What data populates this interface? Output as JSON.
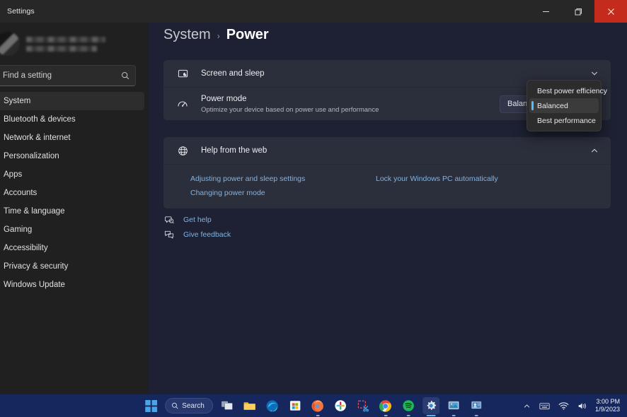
{
  "window": {
    "title": "Settings",
    "controls": {
      "minimize": "minimize",
      "restore": "restore",
      "close": "close"
    }
  },
  "sidebar": {
    "profile": {
      "redacted": true,
      "name_line": "",
      "account_line": ""
    },
    "search": {
      "value": "",
      "placeholder": "Find a setting",
      "icon": "search-icon"
    },
    "items": [
      {
        "label": "System",
        "selected": true
      },
      {
        "label": "Bluetooth & devices",
        "selected": false
      },
      {
        "label": "Network & internet",
        "selected": false
      },
      {
        "label": "Personalization",
        "selected": false
      },
      {
        "label": "Apps",
        "selected": false
      },
      {
        "label": "Accounts",
        "selected": false
      },
      {
        "label": "Time & language",
        "selected": false
      },
      {
        "label": "Gaming",
        "selected": false
      },
      {
        "label": "Accessibility",
        "selected": false
      },
      {
        "label": "Privacy & security",
        "selected": false
      },
      {
        "label": "Windows Update",
        "selected": false
      }
    ]
  },
  "breadcrumb": {
    "root": "System",
    "separator": "›",
    "current": "Power"
  },
  "settings": {
    "screen_and_sleep": {
      "title": "Screen and sleep",
      "icon": "monitor-sleep-icon",
      "expander": "chevron-down-icon"
    },
    "power_mode": {
      "title": "Power mode",
      "subtitle": "Optimize your device based on power use and performance",
      "icon": "power-gauge-icon",
      "selected_value": "Balanced"
    }
  },
  "power_mode_dropdown": {
    "open": true,
    "options": [
      {
        "label": "Best power efficiency",
        "selected": false
      },
      {
        "label": "Balanced",
        "selected": true
      },
      {
        "label": "Best performance",
        "selected": false
      }
    ]
  },
  "help_section": {
    "title": "Help from the web",
    "icon": "globe-icon",
    "expander": "chevron-up-icon",
    "links_column_1": [
      "Adjusting power and sleep settings",
      "Changing power mode"
    ],
    "links_column_2": [
      "Lock your Windows PC automatically"
    ]
  },
  "footer": {
    "get_help": {
      "label": "Get help",
      "icon": "help-icon"
    },
    "give_feedback": {
      "label": "Give feedback",
      "icon": "feedback-icon"
    }
  },
  "taskbar": {
    "start": "start-icon",
    "search": {
      "label": "Search",
      "icon": "search-icon"
    },
    "apps": [
      {
        "name": "task-view",
        "running": false
      },
      {
        "name": "file-explorer",
        "running": false
      },
      {
        "name": "microsoft-edge",
        "running": false
      },
      {
        "name": "microsoft-store",
        "running": false
      },
      {
        "name": "firefox",
        "running": true
      },
      {
        "name": "slack",
        "running": false
      },
      {
        "name": "snipping-tool",
        "running": false
      },
      {
        "name": "google-chrome",
        "running": true
      },
      {
        "name": "spotify",
        "running": true
      },
      {
        "name": "settings",
        "running": true,
        "active": true
      },
      {
        "name": "photos",
        "running": true
      },
      {
        "name": "remote-desktop",
        "running": true
      }
    ],
    "tray": {
      "overflow": "chevron-up-icon",
      "input_indicator": "keyboard-icon",
      "network": "wifi-icon",
      "volume": "speaker-icon"
    },
    "clock": {
      "time": "3:00 PM",
      "date": "1/9/2023"
    }
  },
  "colors": {
    "page_background": "#1e2133",
    "card_background": "#2b2e3b",
    "accent": "#4cc2ff",
    "link": "#7fb4e3",
    "taskbar": "#15275c",
    "close_button": "#c42b1c"
  }
}
